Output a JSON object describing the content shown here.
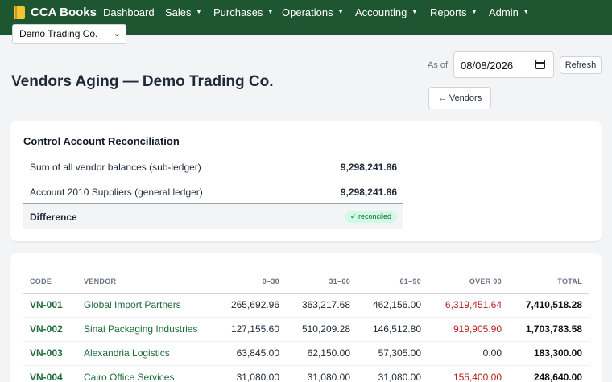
{
  "nav": {
    "brand": "CCA Books",
    "brand_icon": "book-icon",
    "items": [
      {
        "label": "Dashboard",
        "caret": ""
      },
      {
        "label": "Sales",
        "caret": "▼"
      },
      {
        "label": "Purchases",
        "caret": "▼"
      },
      {
        "label": "Operations",
        "caret": "▼"
      },
      {
        "label": "Accounting",
        "caret": "▼"
      },
      {
        "label": "Reports",
        "caret": "▼"
      },
      {
        "label": "Admin",
        "caret": "▼"
      }
    ],
    "company": "Demo Trading Co."
  },
  "header": {
    "title": "Vendors Aging — Demo Trading Co.",
    "as_of_label": "As of",
    "as_of_value": "08/08/2026",
    "refresh_label": "Refresh",
    "back_label": "← Vendors"
  },
  "recon": {
    "title": "Control Account Reconciliation",
    "rows": [
      {
        "label": "Sum of all vendor balances (sub-ledger)",
        "value": "9,298,241.86"
      },
      {
        "label": "Account 2010 Suppliers (general ledger)",
        "value": "9,298,241.86"
      }
    ],
    "difference_label": "Difference",
    "badge": "✓ reconciled"
  },
  "aging": {
    "columns": [
      "CODE",
      "VENDOR",
      "0–30",
      "31–60",
      "61–90",
      "OVER 90",
      "TOTAL"
    ],
    "rows": [
      {
        "code": "VN-001",
        "vendor": "Global Import Partners",
        "b0_30": "265,692.96",
        "b31_60": "363,217.68",
        "b61_90": "462,156.00",
        "over90": "6,319,451.64",
        "total": "7,410,518.28"
      },
      {
        "code": "VN-002",
        "vendor": "Sinai Packaging Industries",
        "b0_30": "127,155.60",
        "b31_60": "510,209.28",
        "b61_90": "146,512.80",
        "over90": "919,905.90",
        "total": "1,703,783.58"
      },
      {
        "code": "VN-003",
        "vendor": "Alexandria Logistics",
        "b0_30": "63,845.00",
        "b31_60": "62,150.00",
        "b61_90": "57,305.00",
        "over90": "0.00",
        "total": "183,300.00"
      },
      {
        "code": "VN-004",
        "vendor": "Cairo Office Services",
        "b0_30": "31,080.00",
        "b31_60": "31,080.00",
        "b61_90": "31,080.00",
        "over90": "155,400.00",
        "total": "248,640.00"
      }
    ]
  },
  "colors": {
    "navbar": "#1e5631",
    "link": "#1e6b3a",
    "overdue": "#b91c1c",
    "badge_bg": "#d1fae5"
  }
}
